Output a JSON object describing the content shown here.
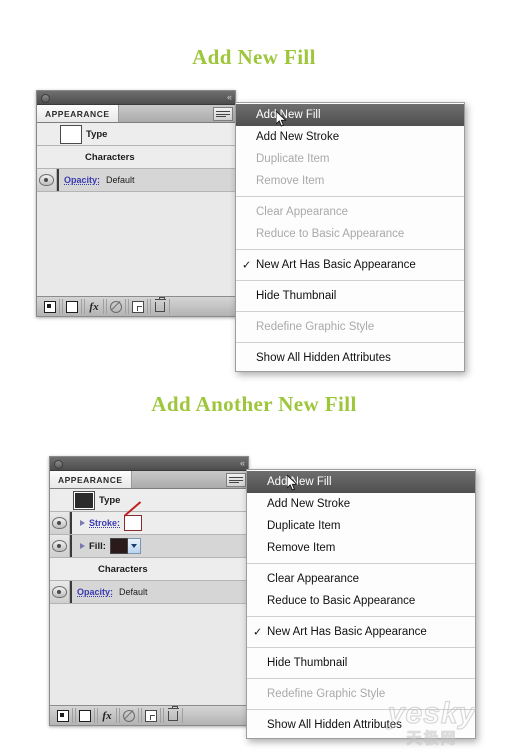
{
  "sections": [
    {
      "title": "Add New Fill"
    },
    {
      "title": "Add Another New Fill"
    }
  ],
  "colors": {
    "heading": "#9dc63b",
    "menu_highlight": "#5c5c5c",
    "link": "#3a3ab0",
    "fill_swatch": "#2a1a1a",
    "stroke_none": "#c02020"
  },
  "panel1": {
    "tab_label": "APPEARANCE",
    "menu_button_icon": "panel-menu-icon",
    "collapse_icon": "collapse-chevrons-icon",
    "rows": [
      {
        "label": "Type",
        "thumb": "white",
        "eye": false,
        "kind": "type"
      },
      {
        "label": "Characters",
        "eye": false,
        "kind": "text"
      },
      {
        "label": "Opacity:",
        "value": "Default",
        "eye": true,
        "kind": "opacity"
      }
    ],
    "toolbar": [
      {
        "name": "new-fill-icon",
        "label": ""
      },
      {
        "name": "new-stroke-icon",
        "label": ""
      },
      {
        "name": "add-effect-icon",
        "label": "fx"
      },
      {
        "name": "clear-appearance-icon",
        "label": ""
      },
      {
        "name": "duplicate-item-icon",
        "label": ""
      },
      {
        "name": "delete-item-icon",
        "label": ""
      }
    ]
  },
  "panel2": {
    "tab_label": "APPEARANCE",
    "menu_button_icon": "panel-menu-icon",
    "collapse_icon": "collapse-chevrons-icon",
    "rows": [
      {
        "label": "Type",
        "thumb": "dark",
        "eye": false,
        "kind": "type"
      },
      {
        "label": "Stroke:",
        "eye": true,
        "kind": "stroke",
        "swatch": "none"
      },
      {
        "label": "Fill:",
        "eye": true,
        "kind": "fill",
        "swatch": "solid"
      },
      {
        "label": "Characters",
        "eye": false,
        "kind": "text"
      },
      {
        "label": "Opacity:",
        "value": "Default",
        "eye": true,
        "kind": "opacity"
      }
    ],
    "toolbar": [
      {
        "name": "new-fill-icon",
        "label": ""
      },
      {
        "name": "new-stroke-icon",
        "label": ""
      },
      {
        "name": "add-effect-icon",
        "label": "fx"
      },
      {
        "name": "clear-appearance-icon",
        "label": ""
      },
      {
        "name": "duplicate-item-icon",
        "label": ""
      },
      {
        "name": "delete-item-icon",
        "label": ""
      }
    ]
  },
  "menu1": {
    "items": [
      {
        "label": "Add New Fill",
        "state": "selected"
      },
      {
        "label": "Add New Stroke",
        "state": "enabled"
      },
      {
        "label": "Duplicate Item",
        "state": "disabled"
      },
      {
        "label": "Remove Item",
        "state": "disabled"
      },
      {
        "separator": true
      },
      {
        "label": "Clear Appearance",
        "state": "disabled"
      },
      {
        "label": "Reduce to Basic Appearance",
        "state": "disabled"
      },
      {
        "separator": true
      },
      {
        "label": "New Art Has Basic Appearance",
        "state": "enabled",
        "checked": true
      },
      {
        "separator": true
      },
      {
        "label": "Hide Thumbnail",
        "state": "enabled"
      },
      {
        "separator": true
      },
      {
        "label": "Redefine Graphic Style",
        "state": "disabled"
      },
      {
        "separator": true
      },
      {
        "label": "Show All Hidden Attributes",
        "state": "enabled"
      }
    ]
  },
  "menu2": {
    "items": [
      {
        "label": "Add New Fill",
        "state": "selected"
      },
      {
        "label": "Add New Stroke",
        "state": "enabled"
      },
      {
        "label": "Duplicate Item",
        "state": "enabled"
      },
      {
        "label": "Remove Item",
        "state": "enabled"
      },
      {
        "separator": true
      },
      {
        "label": "Clear Appearance",
        "state": "enabled"
      },
      {
        "label": "Reduce to Basic Appearance",
        "state": "enabled"
      },
      {
        "separator": true
      },
      {
        "label": "New Art Has Basic Appearance",
        "state": "enabled",
        "checked": true
      },
      {
        "separator": true
      },
      {
        "label": "Hide Thumbnail",
        "state": "enabled"
      },
      {
        "separator": true
      },
      {
        "label": "Redefine Graphic Style",
        "state": "disabled"
      },
      {
        "separator": true
      },
      {
        "label": "Show All Hidden Attributes",
        "state": "enabled"
      }
    ]
  },
  "watermark": {
    "main": "yesky",
    "sub": "天极网"
  },
  "check_glyph": "✓"
}
